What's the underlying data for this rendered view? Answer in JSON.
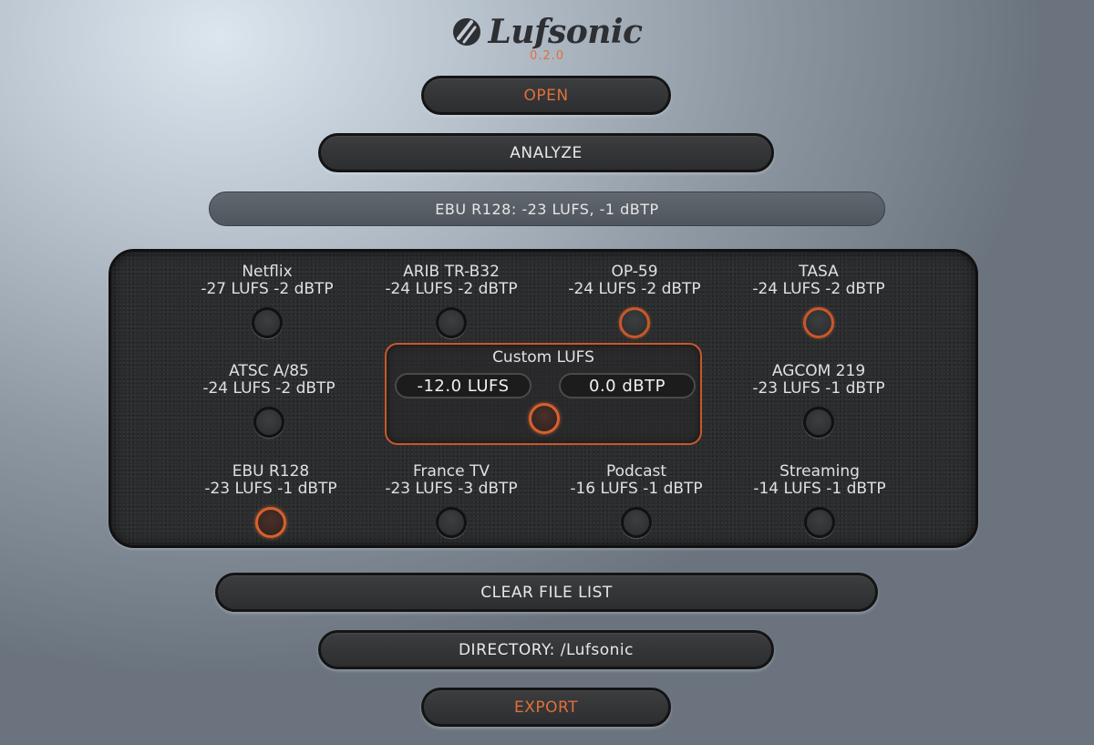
{
  "app": {
    "name": "Lufsonic",
    "version": "0.2.0"
  },
  "buttons": {
    "open": "OPEN",
    "analyze": "ANALYZE",
    "clear": "CLEAR FILE LIST",
    "directory": "DIRECTORY: /Lufsonic",
    "export": "EXPORT"
  },
  "status": "EBU R128: -23 LUFS, -1 dBTP",
  "presets": [
    {
      "name": "Netflix",
      "spec": "-27 LUFS -2 dBTP"
    },
    {
      "name": "ARIB TR-B32",
      "spec": "-24 LUFS -2 dBTP"
    },
    {
      "name": "OP-59",
      "spec": "-24 LUFS -2 dBTP"
    },
    {
      "name": "TASA",
      "spec": "-24 LUFS -2 dBTP"
    },
    {
      "name": "ATSC A/85",
      "spec": "-24 LUFS -2 dBTP"
    },
    {
      "name": "AGCOM 219",
      "spec": "-23 LUFS -1 dBTP"
    },
    {
      "name": "EBU R128",
      "spec": "-23 LUFS -1 dBTP"
    },
    {
      "name": "France TV",
      "spec": "-23 LUFS -3 dBTP"
    },
    {
      "name": "Podcast",
      "spec": "-16 LUFS -1 dBTP"
    },
    {
      "name": "Streaming",
      "spec": "-14 LUFS -1 dBTP"
    }
  ],
  "custom": {
    "title": "Custom LUFS",
    "lufs_value": "-12.0 LUFS",
    "dbtp_value": "0.0 dBTP"
  },
  "colors": {
    "accent": "#e0703a",
    "panel": "#2b2c2e"
  }
}
